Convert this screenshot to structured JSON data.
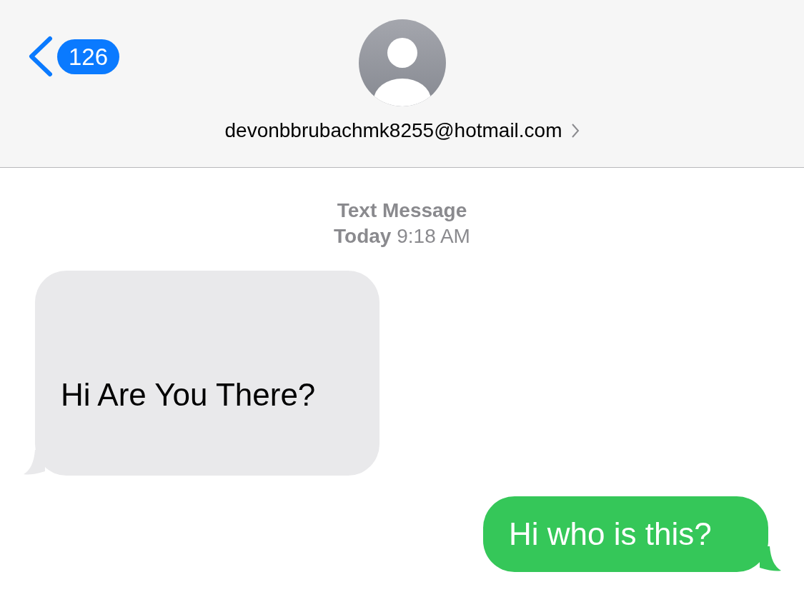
{
  "header": {
    "back_count": "126",
    "contact": "devonbbrubachmk8255@hotmail.com"
  },
  "conversation": {
    "service": "Text Message",
    "timestamp": "**Today** 9:18 AM",
    "messages": [
      {
        "kind": "received",
        "text": "Hi Are You There?"
      },
      {
        "kind": "sent",
        "text": "Hi who is this?"
      }
    ]
  }
}
